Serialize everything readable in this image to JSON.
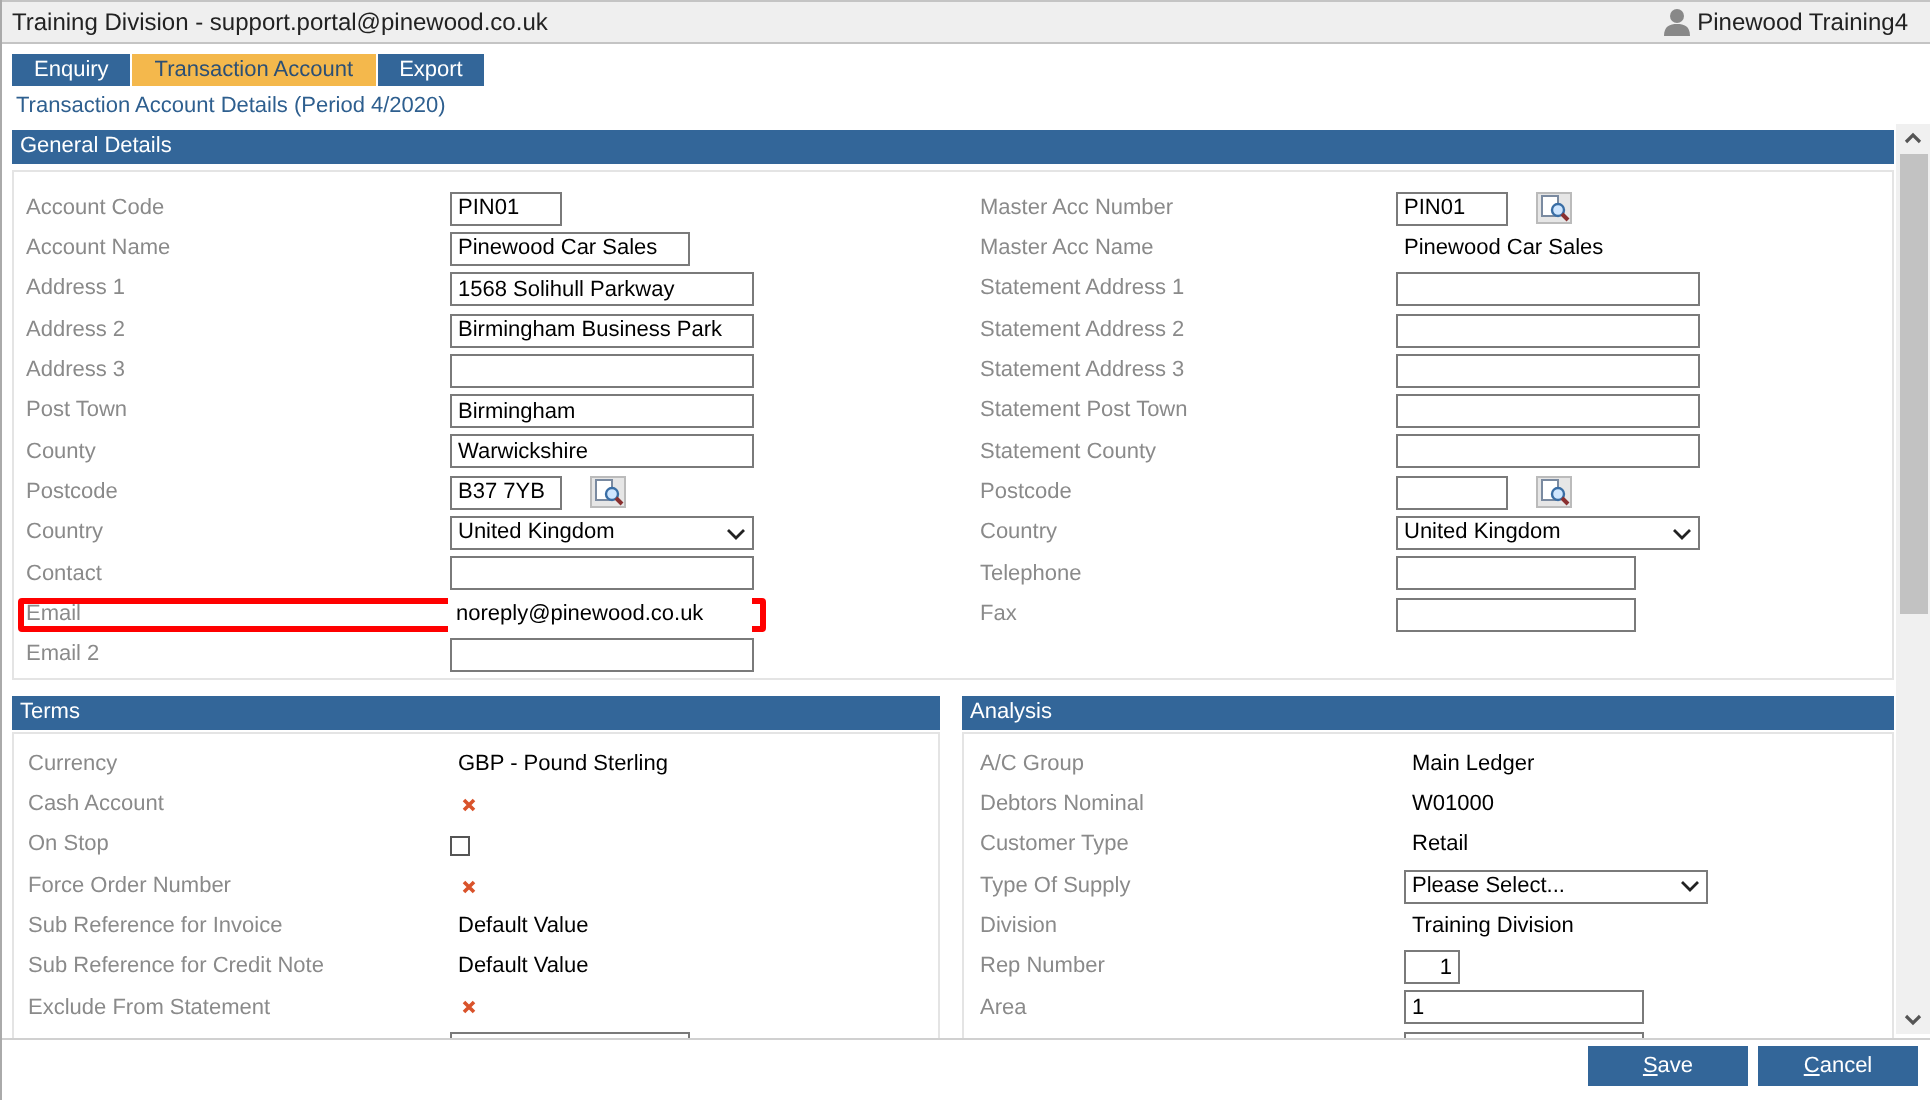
{
  "window": {
    "title": "Training Division - support.portal@pinewood.co.uk",
    "user": "Pinewood Training4"
  },
  "tabs": [
    {
      "label": "Enquiry",
      "selected": false
    },
    {
      "label": "Transaction Account",
      "selected": true
    },
    {
      "label": "Export",
      "selected": false
    }
  ],
  "subtitle": "Transaction Account Details (Period 4/2020)",
  "general_details": {
    "title": "General Details",
    "left": [
      {
        "label": "Account Code",
        "kind": "short",
        "value": "PIN01"
      },
      {
        "label": "Account Name",
        "kind": "medium",
        "value": "Pinewood Car Sales"
      },
      {
        "label": "Address 1",
        "kind": "long",
        "value": "1568 Solihull Parkway"
      },
      {
        "label": "Address 2",
        "kind": "long",
        "value": "Birmingham Business Park"
      },
      {
        "label": "Address 3",
        "kind": "long"
      },
      {
        "label": "Post Town",
        "kind": "long",
        "value": "Birmingham"
      },
      {
        "label": "County",
        "kind": "long",
        "value": "Warwickshire"
      },
      {
        "label": "Postcode",
        "kind": "lookup",
        "value": "B37 7YB"
      },
      {
        "label": "Country",
        "kind": "select",
        "value": "United Kingdom"
      },
      {
        "label": "Contact",
        "kind": "long"
      },
      {
        "label": "Email",
        "kind": "long",
        "value": "noreply@pinewood.co.uk",
        "highlighted": true
      },
      {
        "label": "Email 2",
        "kind": "long"
      }
    ],
    "right": [
      {
        "label": "Master Acc Number",
        "kind": "lookup",
        "value": "PIN01"
      },
      {
        "label": "Master Acc Name",
        "kind": "text",
        "value": "Pinewood Car Sales"
      },
      {
        "label": "Statement Address 1",
        "kind": "long"
      },
      {
        "label": "Statement Address 2",
        "kind": "long"
      },
      {
        "label": "Statement Address 3",
        "kind": "long"
      },
      {
        "label": "Statement Post Town",
        "kind": "long"
      },
      {
        "label": "Statement County",
        "kind": "long"
      },
      {
        "label": "Postcode",
        "kind": "lookup"
      },
      {
        "label": "Country",
        "kind": "select",
        "value": "United Kingdom"
      },
      {
        "label": "Telephone",
        "kind": "medium"
      },
      {
        "label": "Fax",
        "kind": "medium"
      }
    ]
  },
  "terms": {
    "title": "Terms",
    "rows": [
      {
        "label": "Currency",
        "kind": "text",
        "value": "GBP - Pound Sterling"
      },
      {
        "label": "Cash Account",
        "kind": "cross"
      },
      {
        "label": "On Stop",
        "kind": "checkbox",
        "checked": false
      },
      {
        "label": "Force Order Number",
        "kind": "cross"
      },
      {
        "label": "Sub Reference for Invoice",
        "kind": "text",
        "value": "Default Value"
      },
      {
        "label": "Sub Reference for Credit Note",
        "kind": "text",
        "value": "Default Value"
      },
      {
        "label": "Exclude From Statement",
        "kind": "cross"
      },
      {
        "kind": "medium"
      }
    ]
  },
  "analysis": {
    "title": "Analysis",
    "rows": [
      {
        "label": "A/C Group",
        "kind": "text",
        "value": "Main Ledger"
      },
      {
        "label": "Debtors Nominal",
        "kind": "text",
        "value": "W01000"
      },
      {
        "label": "Customer Type",
        "kind": "text",
        "value": "Retail"
      },
      {
        "label": "Type Of Supply",
        "kind": "select",
        "value": "Please Select..."
      },
      {
        "label": "Division",
        "kind": "text",
        "value": "Training Division"
      },
      {
        "label": "Rep Number",
        "kind": "number",
        "value": "1"
      },
      {
        "label": "Area",
        "kind": "medium",
        "value": "1"
      },
      {
        "kind": "medium"
      }
    ]
  },
  "buttons": [
    {
      "label": "Save"
    },
    {
      "label": "Cancel"
    }
  ]
}
